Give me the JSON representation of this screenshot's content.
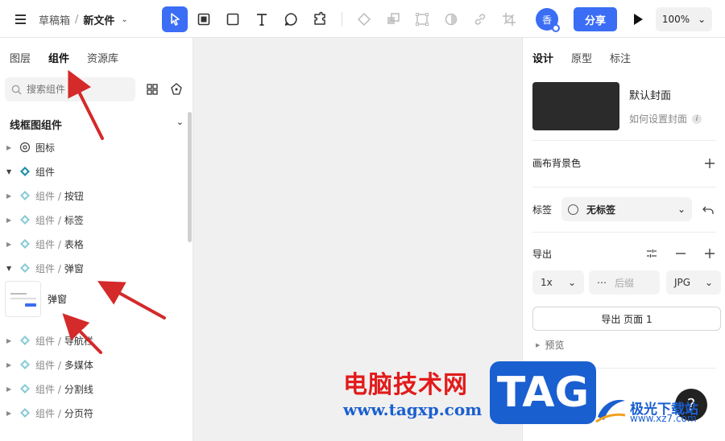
{
  "topbar": {
    "breadcrumb_root": "草稿箱",
    "breadcrumb_sep": "/",
    "file_name": "新文件",
    "avatar_text": "香",
    "share_label": "分享",
    "zoom_value": "100%"
  },
  "left": {
    "tabs": [
      {
        "label": "图层"
      },
      {
        "label": "组件"
      },
      {
        "label": "资源库"
      }
    ],
    "search_placeholder": "搜索组件",
    "section_title": "线框图组件",
    "tree": [
      {
        "path": "",
        "name": "图标"
      },
      {
        "path": "",
        "name": "组件"
      },
      {
        "path": "组件 /",
        "name": "按钮"
      },
      {
        "path": "组件 /",
        "name": "标签"
      },
      {
        "path": "组件 /",
        "name": "表格"
      },
      {
        "path": "组件 /",
        "name": "弹窗"
      },
      {
        "path": "组件 /",
        "name": "导航栏"
      },
      {
        "path": "组件 /",
        "name": "多媒体"
      },
      {
        "path": "组件 /",
        "name": "分割线"
      },
      {
        "path": "组件 /",
        "name": "分页符"
      }
    ],
    "component_card_label": "弹窗"
  },
  "right": {
    "tabs": [
      {
        "label": "设计"
      },
      {
        "label": "原型"
      },
      {
        "label": "标注"
      }
    ],
    "cover_title": "默认封面",
    "cover_help": "如何设置封面",
    "canvas_bg_label": "画布背景色",
    "tag_label": "标签",
    "tag_value": "无标签",
    "export_label": "导出",
    "scale_value": "1x",
    "suffix_placeholder": "后缀",
    "format_value": "JPG",
    "export_button": "导出 页面 1",
    "preview_label": "预览"
  },
  "watermarks": {
    "site_cn": "电脑技术网",
    "site_url": "www.tagxp.com",
    "tag_text": "TAG",
    "jg_name": "极光下载站",
    "jg_url": "www.xz7.com"
  },
  "colors": {
    "accent": "#3b6df5",
    "canvas": "#f0f0f0",
    "annotation_arrow": "#d42a2a"
  }
}
